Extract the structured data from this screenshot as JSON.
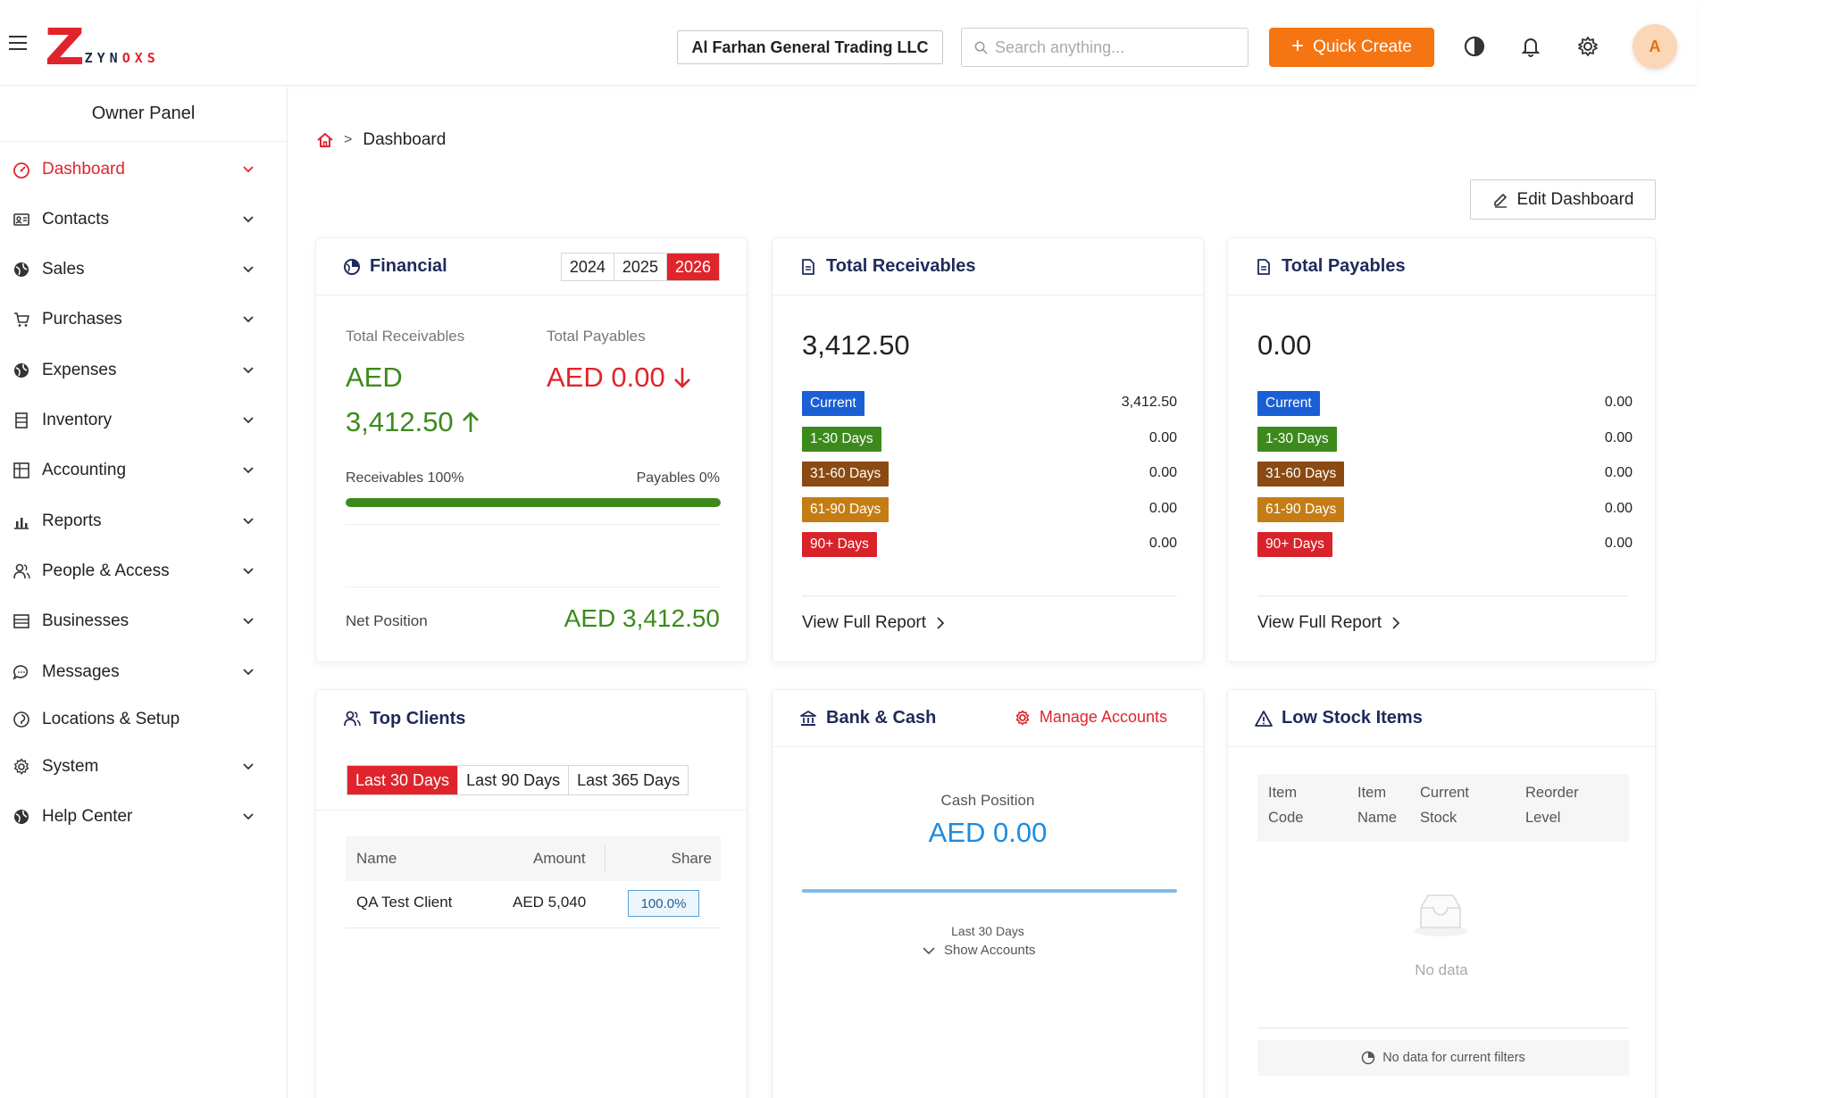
{
  "header": {
    "logo_letter": "Z",
    "logo_text_a": "ZYN",
    "logo_text_b": "OXS",
    "company": "Al Farhan General Trading LLC",
    "search_placeholder": "Search anything...",
    "quick_create": "Quick Create",
    "avatar_initial": "A"
  },
  "sidebar": {
    "panel_title": "Owner Panel",
    "items": [
      {
        "label": "Dashboard",
        "icon": "dashboard-icon",
        "active": true,
        "chevron": true
      },
      {
        "label": "Contacts",
        "icon": "contacts-icon",
        "chevron": true
      },
      {
        "label": "Sales",
        "icon": "sales-icon",
        "chevron": true
      },
      {
        "label": "Purchases",
        "icon": "cart-icon",
        "chevron": true
      },
      {
        "label": "Expenses",
        "icon": "expenses-icon",
        "chevron": true
      },
      {
        "label": "Inventory",
        "icon": "inventory-icon",
        "chevron": true
      },
      {
        "label": "Accounting",
        "icon": "accounting-icon",
        "chevron": true
      },
      {
        "label": "Reports",
        "icon": "reports-icon",
        "chevron": true
      },
      {
        "label": "People & Access",
        "icon": "people-icon",
        "chevron": true
      },
      {
        "label": "Businesses",
        "icon": "businesses-icon",
        "chevron": true
      },
      {
        "label": "Messages",
        "icon": "messages-icon",
        "chevron": true
      },
      {
        "label": "Locations & Setup",
        "icon": "location-icon",
        "chevron": false
      },
      {
        "label": "System",
        "icon": "system-gear-icon",
        "chevron": true
      },
      {
        "label": "Help Center",
        "icon": "help-icon",
        "chevron": true
      }
    ]
  },
  "breadcrumb": {
    "sep": ">",
    "current": "Dashboard"
  },
  "edit_dashboard": "Edit Dashboard",
  "financial": {
    "title": "Financial",
    "years": [
      "2024",
      "2025",
      "2026"
    ],
    "active_year": "2026",
    "receivables_label": "Total Receivables",
    "receivables_currency": "AED",
    "receivables_amount": "3,412.50",
    "payables_label": "Total Payables",
    "payables_value": "AED 0.00",
    "receivables_pct_label": "Receivables 100%",
    "payables_pct_label": "Payables 0%",
    "receivables_share": 1.0,
    "net_label": "Net Position",
    "net_value": "AED 3,412.50"
  },
  "receivables": {
    "title": "Total Receivables",
    "total": "3,412.50",
    "buckets": [
      {
        "label": "Current",
        "value": "3,412.50",
        "color": "#1a5fd6"
      },
      {
        "label": "1-30 Days",
        "value": "0.00",
        "color": "#3c8a1c"
      },
      {
        "label": "31-60 Days",
        "value": "0.00",
        "color": "#8a4a12"
      },
      {
        "label": "61-90 Days",
        "value": "0.00",
        "color": "#c47d14"
      },
      {
        "label": "90+ Days",
        "value": "0.00",
        "color": "#d8232b"
      }
    ],
    "view_report": "View Full Report"
  },
  "payables": {
    "title": "Total Payables",
    "total": "0.00",
    "buckets": [
      {
        "label": "Current",
        "value": "0.00",
        "color": "#1a5fd6"
      },
      {
        "label": "1-30 Days",
        "value": "0.00",
        "color": "#3c8a1c"
      },
      {
        "label": "31-60 Days",
        "value": "0.00",
        "color": "#8a4a12"
      },
      {
        "label": "61-90 Days",
        "value": "0.00",
        "color": "#c47d14"
      },
      {
        "label": "90+ Days",
        "value": "0.00",
        "color": "#d8232b"
      }
    ],
    "view_report": "View Full Report"
  },
  "top_clients": {
    "title": "Top Clients",
    "ranges": [
      "Last 30 Days",
      "Last 90 Days",
      "Last 365 Days"
    ],
    "active_range": "Last 30 Days",
    "columns": [
      "Name",
      "Amount",
      "Share"
    ],
    "rows": [
      {
        "name": "QA Test Client",
        "amount": "AED 5,040",
        "share": "100.0%"
      }
    ]
  },
  "bank_cash": {
    "title": "Bank & Cash",
    "manage": "Manage Accounts",
    "cash_label": "Cash Position",
    "cash_value": "AED 0.00",
    "period": "Last 30 Days",
    "show_accounts": "Show Accounts"
  },
  "low_stock": {
    "title": "Low Stock Items",
    "columns": [
      [
        "Item",
        "Code"
      ],
      [
        "Item",
        "Name"
      ],
      [
        "Current",
        "Stock"
      ],
      [
        "Reorder",
        "Level"
      ]
    ],
    "empty": "No data",
    "footer": "No data for current filters"
  },
  "colors": {
    "brand_red": "#e0242c",
    "accent_orange": "#f57512",
    "green": "#3c8a1c",
    "blue": "#1d8ce0"
  }
}
